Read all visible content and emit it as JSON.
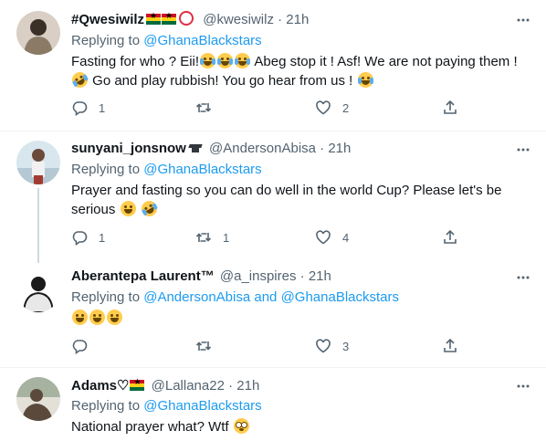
{
  "tweets": [
    {
      "display_name": "#Qwesiwilz",
      "name_emoji": [
        "ghana-flag-icon",
        "ghana-flag-icon",
        "red-circle-icon"
      ],
      "handle": "@kwesiwilz",
      "time": "21h",
      "replying_label": "Replying to",
      "replying_to": [
        "@GhanaBlackstars"
      ],
      "text_lines": [
        "Fasting for who ? Eii!",
        " Abeg stop it !  Asf! We are not paying them !",
        " Go and play rubbish! You go hear from us ! "
      ],
      "actions": {
        "replies": "1",
        "retweets": "",
        "likes": "2"
      },
      "avatar_colors": [
        "#8a7a66",
        "#d9cfc4",
        "#3b3028"
      ]
    },
    {
      "display_name": "sunyani_jonsnow",
      "name_emoji": [
        "graduation-cap-icon"
      ],
      "handle": "@AndersonAbisa",
      "time": "21h",
      "replying_label": "Replying to",
      "replying_to": [
        "@GhanaBlackstars"
      ],
      "text_lines": [
        "Prayer and fasting so you can do well in the world Cup? Please let's be",
        "serious "
      ],
      "actions": {
        "replies": "1",
        "retweets": "1",
        "likes": "4"
      },
      "avatar_colors": [
        "#d8e6ee",
        "#a23b2f",
        "#f1f1f1"
      ]
    },
    {
      "display_name": "Aberantepa Laurent™",
      "name_emoji": [],
      "handle": "@a_inspires",
      "time": "21h",
      "replying_label": "Replying to",
      "replying_to": [
        "@AndersonAbisa",
        "@GhanaBlackstars"
      ],
      "replying_join": "and",
      "text_lines": [
        ""
      ],
      "actions": {
        "replies": "",
        "retweets": "",
        "likes": "3"
      },
      "avatar_colors": [
        "#ffffff",
        "#1a1a1a",
        "#e8e8e8"
      ]
    },
    {
      "display_name": "Adams♡",
      "name_emoji": [
        "ghana-flag-icon"
      ],
      "handle": "@Lallana22",
      "time": "21h",
      "replying_label": "Replying to",
      "replying_to": [
        "@GhanaBlackstars"
      ],
      "text_lines": [
        "National prayer what? Wtf "
      ],
      "actions": {
        "replies": "",
        "retweets": "",
        "likes": ""
      },
      "avatar_colors": [
        "#a7b3a0",
        "#5b4a3c",
        "#e3e0d8"
      ]
    }
  ],
  "colors": {
    "link": "#1d9bf0",
    "muted": "#536471",
    "divider": "#eff3f4",
    "thread": "#cfd9de"
  }
}
